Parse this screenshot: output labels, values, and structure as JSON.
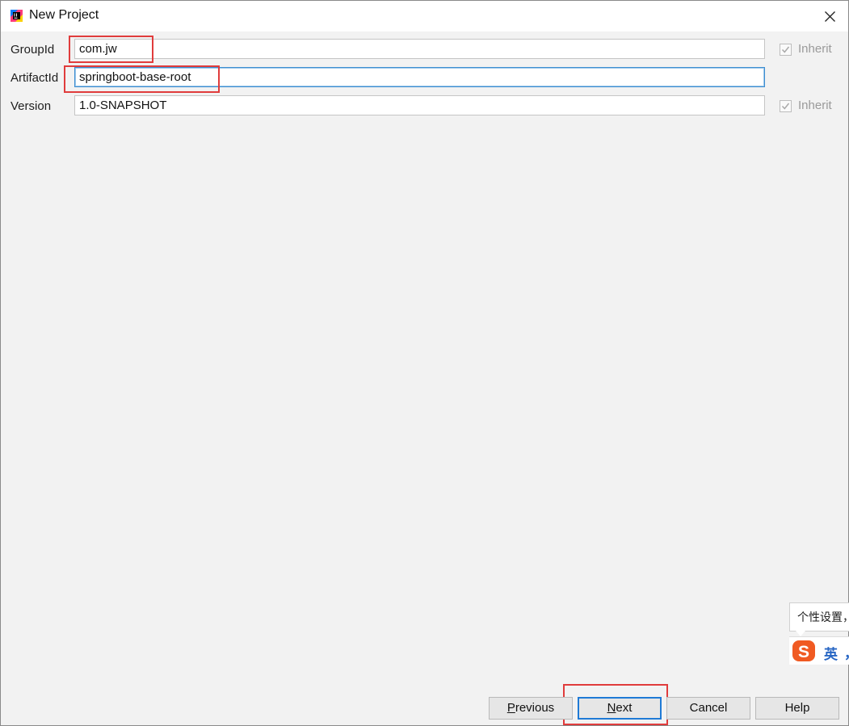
{
  "window": {
    "title": "New Project",
    "icon": "intellij-idea-icon"
  },
  "form": {
    "groupid_label": "GroupId",
    "groupid_value": "com.jw",
    "artifactid_label": "ArtifactId",
    "artifactid_value": "springboot-base-root",
    "version_label": "Version",
    "version_value": "1.0-SNAPSHOT",
    "inherit_label": "Inherit",
    "inherit_checked": true
  },
  "buttons": {
    "previous": {
      "pre": "",
      "mnemonic": "P",
      "post": "revious"
    },
    "next": {
      "pre": "",
      "mnemonic": "N",
      "post": "ext"
    },
    "cancel": "Cancel",
    "help": "Help"
  },
  "ime": {
    "tooltip": "个性设置，",
    "mode": "英",
    "tail": "，"
  },
  "colors": {
    "highlight": "#e03c3c",
    "focus": "#3d8ed1",
    "default_button_border": "#1f7ad6",
    "ime_logo": "#f05a22"
  }
}
